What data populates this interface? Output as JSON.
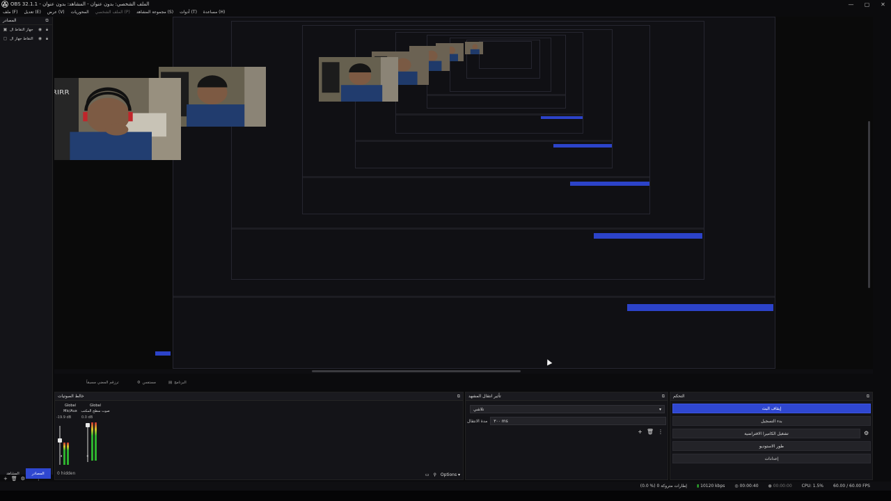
{
  "window": {
    "title": "OBS 32.1.1 - الملف الشخصي: بدون عنوان - المشاهد: بدون عنوان",
    "controls": [
      "—",
      "▢",
      "✕"
    ]
  },
  "menu": [
    {
      "label": "ملف (F)",
      "dim": false
    },
    {
      "label": "تعديل (E)",
      "dim": false
    },
    {
      "label": "عرض (V)",
      "dim": false
    },
    {
      "label": "المحوريات",
      "dim": false
    },
    {
      "label": "الملف الشخصي (P)",
      "dim": true
    },
    {
      "label": "مجموعة المشاهد (S)",
      "dim": false
    },
    {
      "label": "أدوات (T)",
      "dim": false
    },
    {
      "label": "مساعدة (H)",
      "dim": false
    }
  ],
  "sources": {
    "header": "المصادر",
    "items": [
      "جهاز التقاط ال",
      "التقاط جهاز ال"
    ]
  },
  "tabs": {
    "record_label": "ترزقم المضي مسبقاً",
    "settings_label": "مستفس",
    "stats_label": "البرنامج"
  },
  "mixer": {
    "header": "خالط الصوتيات",
    "channels": [
      {
        "global": "Global",
        "name": "Mic/Aux",
        "db": "-19.9 dB",
        "level": 0.55
      },
      {
        "global": "Global",
        "name": "صوت سطح المكتب",
        "db": "0.0 dB",
        "level": 0.95
      }
    ],
    "hidden": "0 hidden",
    "options_label": "Options"
  },
  "transitions": {
    "header": "تأثير انتقال المشهد",
    "selected": "تلاشي",
    "duration_label": "مدة الانتقال",
    "duration_value": "٣٠٠ ms"
  },
  "controls": {
    "header": "التحكم",
    "buttons": [
      "إيقاف البث",
      "بدء التسجيل",
      "تشغيل الكاميرا الافتراضية",
      "طور الاستوديو",
      "إعدادات"
    ]
  },
  "bottom_tabs": {
    "scenes": "المشاهد",
    "sources": "المصادر"
  },
  "status": {
    "dropped": "(0.0 %) 0 إطارات متروكة",
    "bitrate": "10120 kbps",
    "stream_time": "00:00:40",
    "rec_time": "00:00:00",
    "cpu": "CPU: 1.5%",
    "fps": "60.00 / 60.00 FPS"
  },
  "colors": {
    "accent": "#2f47d0",
    "panel": "#141418",
    "background": "#0b0b0d"
  }
}
